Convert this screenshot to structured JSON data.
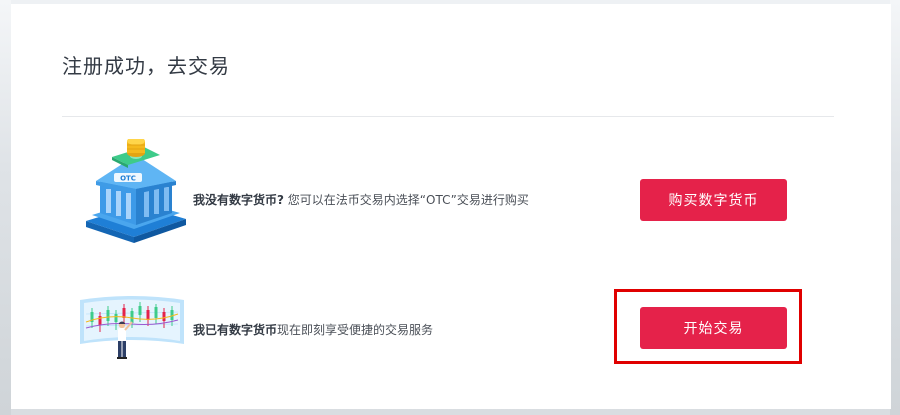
{
  "page": {
    "title": "注册成功，去交易"
  },
  "options": [
    {
      "strong": "我没有数字货币?",
      "description": " 您可以在法币交易内选择“OTC”交易进行购买",
      "button_label": "购买数字货币",
      "illustration_label": "OTC"
    },
    {
      "strong": "我已有数字货币",
      "description": "现在即刻享受便捷的交易服务",
      "button_label": "开始交易"
    }
  ],
  "colors": {
    "accent": "#e5224a",
    "highlight": "#e00000",
    "title": "#333a44"
  },
  "icons": {
    "option_1": "bank-coin-illustration",
    "option_2": "trader-chart-illustration"
  }
}
